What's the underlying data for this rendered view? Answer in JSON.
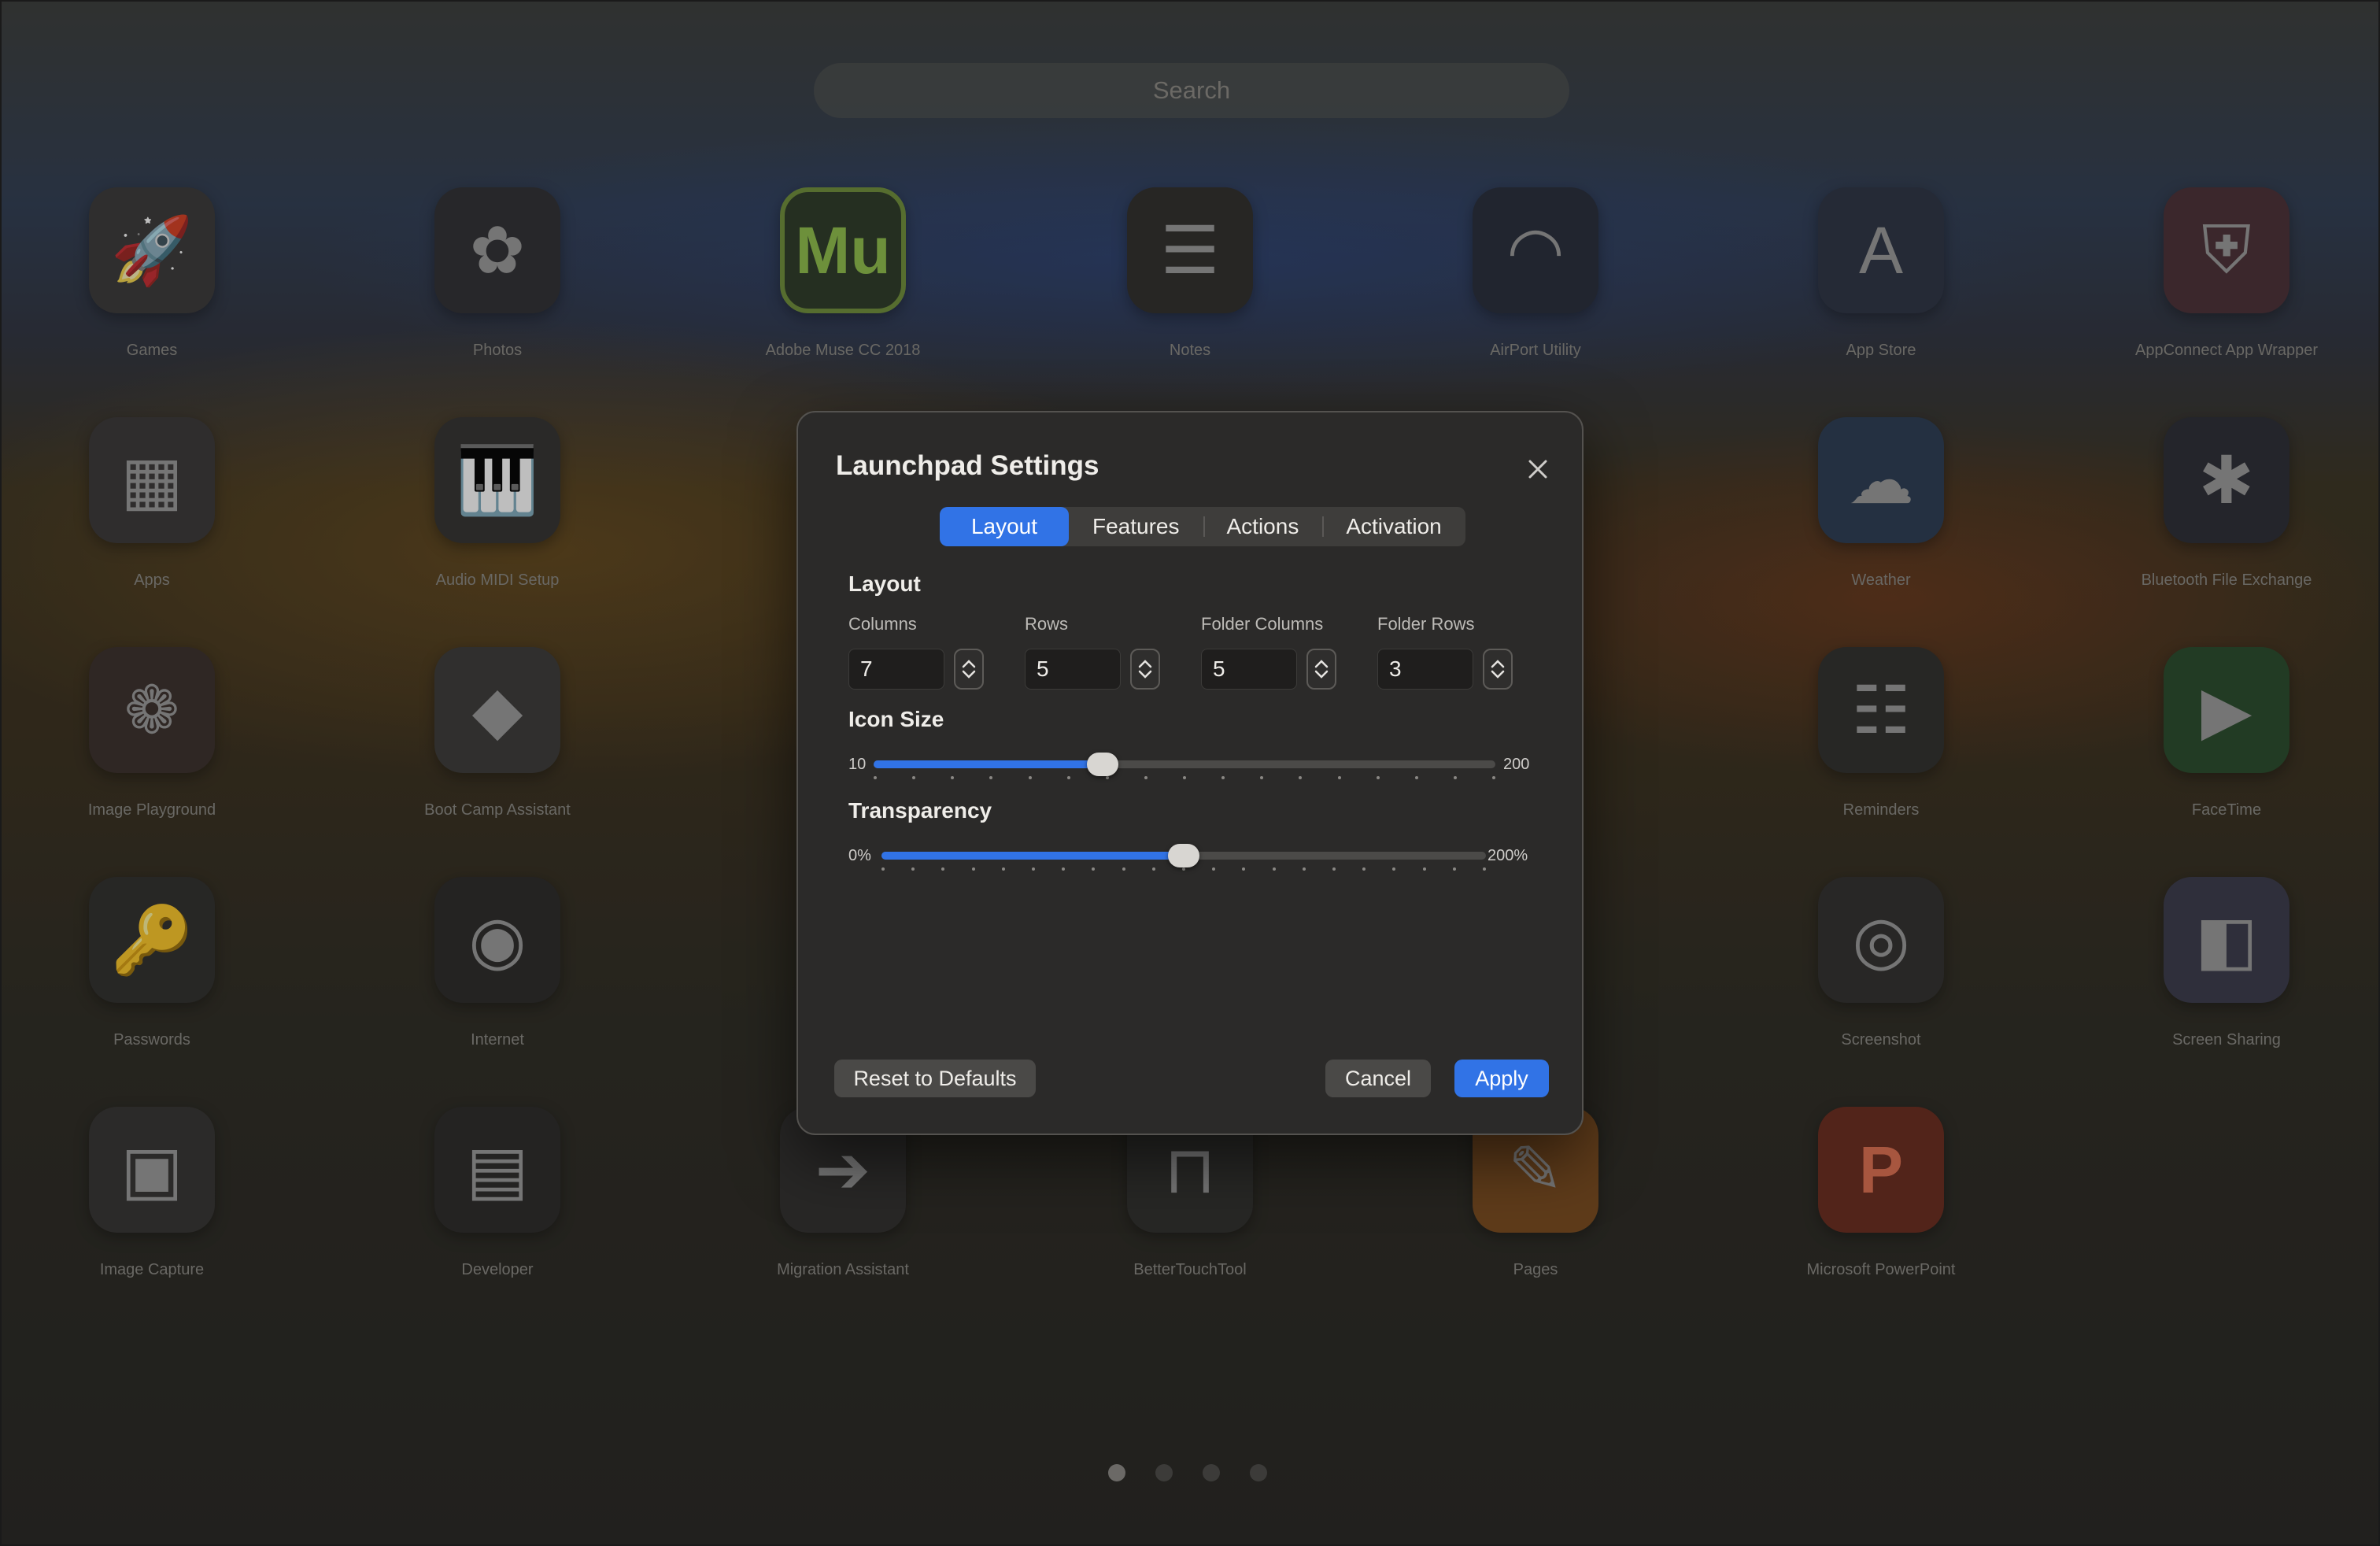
{
  "search": {
    "placeholder": "Search"
  },
  "apps": [
    {
      "name": "Games",
      "glyph": "🚀",
      "bg": "#3a3838"
    },
    {
      "name": "Photos",
      "glyph": "✿",
      "bg": "#2f2f33"
    },
    {
      "name": "Adobe Muse CC 2018",
      "glyph": "Mu",
      "bg": "#2c3a26"
    },
    {
      "name": "Notes",
      "glyph": "☰",
      "bg": "#2e2d2a"
    },
    {
      "name": "AirPort Utility",
      "glyph": "◠",
      "bg": "#262b3a"
    },
    {
      "name": "App Store",
      "glyph": "A",
      "bg": "#2b3243"
    },
    {
      "name": "AppConnect App Wrapper",
      "glyph": "⛨",
      "bg": "#4a2f35"
    },
    {
      "name": "Apps",
      "glyph": "▦",
      "bg": "#3a3636"
    },
    {
      "name": "Audio MIDI Setup",
      "glyph": "🎹",
      "bg": "#333130"
    },
    {
      "name": "Weather",
      "glyph": "☁",
      "bg": "#2a3b52"
    },
    {
      "name": "Bluetooth File Exchange",
      "glyph": "✱",
      "bg": "#2a2c34"
    },
    {
      "name": "Image Playground",
      "glyph": "❁",
      "bg": "#3a2e2a"
    },
    {
      "name": "Boot Camp Assistant",
      "glyph": "◆",
      "bg": "#3b3a38"
    },
    {
      "name": "Reminders",
      "glyph": "☷",
      "bg": "#2f2e2c"
    },
    {
      "name": "FaceTime",
      "glyph": "▶",
      "bg": "#284a2a"
    },
    {
      "name": "Passwords",
      "glyph": "🔑",
      "bg": "#2f2e2c"
    },
    {
      "name": "Internet",
      "glyph": "◉",
      "bg": "#2a2928"
    },
    {
      "name": "Screenshot",
      "glyph": "◎",
      "bg": "#302f2d"
    },
    {
      "name": "Screen Sharing",
      "glyph": "◧",
      "bg": "#3a3a4a"
    },
    {
      "name": "Image Capture",
      "glyph": "▣",
      "bg": "#343331"
    },
    {
      "name": "Developer",
      "glyph": "▤",
      "bg": "#2a2928"
    },
    {
      "name": "Migration Assistant",
      "glyph": "➔",
      "bg": "#302f2d"
    },
    {
      "name": "BetterTouchTool",
      "glyph": "⊓",
      "bg": "#2f2e2c"
    },
    {
      "name": "Pages",
      "glyph": "✎",
      "bg": "#7a4a1c"
    },
    {
      "name": "Microsoft PowerPoint",
      "glyph": "P",
      "bg": "#6a2a1c"
    }
  ],
  "dialog": {
    "title": "Launchpad Settings",
    "close_icon": "xmark",
    "tabs": [
      "Layout",
      "Features",
      "Actions",
      "Activation"
    ],
    "active_tab": "Layout",
    "layout_section": "Layout",
    "fields": [
      {
        "label": "Columns",
        "value": "7"
      },
      {
        "label": "Rows",
        "value": "5"
      },
      {
        "label": "Folder Columns",
        "value": "5"
      },
      {
        "label": "Folder Rows",
        "value": "3"
      }
    ],
    "icon_size": {
      "label": "Icon Size",
      "min": "10",
      "max": "200",
      "value": 80,
      "range": [
        10,
        200
      ]
    },
    "transparency": {
      "label": "Transparency",
      "min": "0%",
      "max": "200%",
      "value": 100,
      "range": [
        0,
        200
      ]
    },
    "buttons": {
      "reset": "Reset to Defaults",
      "cancel": "Cancel",
      "apply": "Apply"
    },
    "accent_color": "#3173e6"
  },
  "pager": {
    "pages": 4,
    "current": 1
  }
}
